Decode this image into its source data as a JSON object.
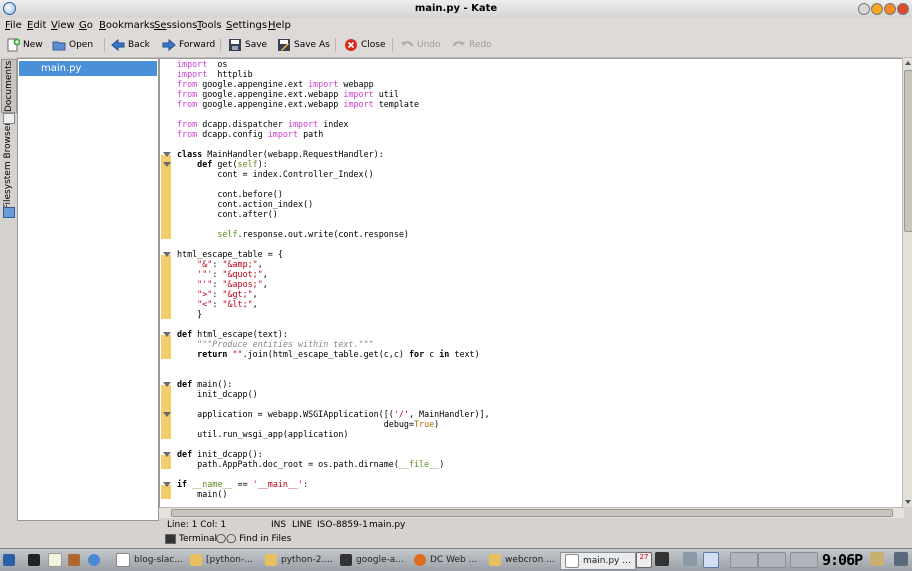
{
  "window": {
    "title": "main.py - Kate"
  },
  "menu": [
    {
      "label": "File",
      "u": "F",
      "rest": "ile"
    },
    {
      "label": "Edit",
      "u": "E",
      "rest": "dit"
    },
    {
      "label": "View",
      "u": "V",
      "rest": "iew"
    },
    {
      "label": "Go",
      "u": "G",
      "rest": "o"
    },
    {
      "label": "Bookmarks",
      "u": "B",
      "rest": "ookmarks"
    },
    {
      "label": "Sessions",
      "u": "Se",
      "rest": "ssions"
    },
    {
      "label": "Tools",
      "u": "T",
      "rest": "ools"
    },
    {
      "label": "Settings",
      "u": "S",
      "rest": "ettings"
    },
    {
      "label": "Help",
      "u": "H",
      "rest": "elp"
    }
  ],
  "toolbar": {
    "new": "New",
    "open": "Open",
    "back": "Back",
    "forward": "Forward",
    "save": "Save",
    "save_as": "Save As",
    "close": "Close",
    "undo": "Undo",
    "redo": "Redo"
  },
  "sidetabs": {
    "documents": "Documents",
    "filesystem": "Filesystem Browser"
  },
  "documents": [
    "main.py"
  ],
  "code_lines": [
    [
      [
        "imp",
        "import"
      ],
      [
        "",
        "  os"
      ]
    ],
    [
      [
        "imp",
        "import"
      ],
      [
        "",
        "  httplib"
      ]
    ],
    [
      [
        "imp",
        "from"
      ],
      [
        "",
        " google.appengine.ext "
      ],
      [
        "imp",
        "import"
      ],
      [
        "",
        " webapp"
      ]
    ],
    [
      [
        "imp",
        "from"
      ],
      [
        "",
        " google.appengine.ext.webapp "
      ],
      [
        "imp",
        "import"
      ],
      [
        "",
        " util"
      ]
    ],
    [
      [
        "imp",
        "from"
      ],
      [
        "",
        " google.appengine.ext.webapp "
      ],
      [
        "imp",
        "import"
      ],
      [
        "",
        " template"
      ]
    ],
    [],
    [
      [
        "imp",
        "from"
      ],
      [
        "",
        " dcapp.dispatcher "
      ],
      [
        "imp",
        "import"
      ],
      [
        "",
        " index"
      ]
    ],
    [
      [
        "imp",
        "from"
      ],
      [
        "",
        " dcapp.config "
      ],
      [
        "imp",
        "import"
      ],
      [
        "",
        " path"
      ]
    ],
    [],
    [
      [
        "kw",
        "class"
      ],
      [
        "",
        " MainHandler(webapp.RequestHandler):"
      ]
    ],
    [
      [
        "",
        "    "
      ],
      [
        "kw",
        "def"
      ],
      [
        "",
        " get("
      ],
      [
        "slf",
        "self"
      ],
      [
        "",
        "):"
      ]
    ],
    [
      [
        "",
        "        cont = index.Controller_Index()"
      ]
    ],
    [],
    [
      [
        "",
        "        cont.before()"
      ]
    ],
    [
      [
        "",
        "        cont.action_index()"
      ]
    ],
    [
      [
        "",
        "        cont.after()"
      ]
    ],
    [],
    [
      [
        "",
        "        "
      ],
      [
        "slf",
        "self"
      ],
      [
        "",
        ".response.out.write(cont.response)"
      ]
    ],
    [],
    [
      [
        "",
        "html_escape_table = {"
      ]
    ],
    [
      [
        "",
        "    "
      ],
      [
        "str",
        "\"&\""
      ],
      [
        "",
        ": "
      ],
      [
        "str",
        "\"&amp;\""
      ],
      [
        "",
        ","
      ]
    ],
    [
      [
        "",
        "    "
      ],
      [
        "str",
        "'\"'"
      ],
      [
        "",
        ": "
      ],
      [
        "str",
        "\"&quot;\""
      ],
      [
        "",
        ","
      ]
    ],
    [
      [
        "",
        "    "
      ],
      [
        "str",
        "\"'\""
      ],
      [
        "",
        ": "
      ],
      [
        "str",
        "\"&apos;\""
      ],
      [
        "",
        ","
      ]
    ],
    [
      [
        "",
        "    "
      ],
      [
        "str",
        "\">\""
      ],
      [
        "",
        ": "
      ],
      [
        "str",
        "\"&gt;\""
      ],
      [
        "",
        ","
      ]
    ],
    [
      [
        "",
        "    "
      ],
      [
        "str",
        "\"<\""
      ],
      [
        "",
        ": "
      ],
      [
        "str",
        "\"&lt;\""
      ],
      [
        "",
        ","
      ]
    ],
    [
      [
        "",
        "    }"
      ]
    ],
    [],
    [
      [
        "kw",
        "def"
      ],
      [
        "",
        " html_escape(text):"
      ]
    ],
    [
      [
        "",
        "    "
      ],
      [
        "doc",
        "\"\"\"Produce entities within text.\"\"\""
      ]
    ],
    [
      [
        "",
        "    "
      ],
      [
        "kw",
        "return"
      ],
      [
        "",
        " "
      ],
      [
        "str",
        "\"\""
      ],
      [
        "",
        ".join(html_escape_table.get(c,c) "
      ],
      [
        "kw",
        "for"
      ],
      [
        "",
        " c "
      ],
      [
        "kw",
        "in"
      ],
      [
        "",
        " text)"
      ]
    ],
    [],
    [],
    [
      [
        "kw",
        "def"
      ],
      [
        "",
        " main():"
      ]
    ],
    [
      [
        "",
        "    init_dcapp()"
      ]
    ],
    [],
    [
      [
        "",
        "    application = webapp.WSGIApplication([("
      ],
      [
        "str",
        "'/'"
      ],
      [
        "",
        ", MainHandler)],"
      ]
    ],
    [
      [
        "",
        "                                         debug="
      ],
      [
        "bool",
        "True"
      ],
      [
        "",
        ")"
      ]
    ],
    [
      [
        "",
        "    util.run_wsgi_app(application)"
      ]
    ],
    [],
    [
      [
        "kw",
        "def"
      ],
      [
        "",
        " init_dcapp():"
      ]
    ],
    [
      [
        "",
        "    path.AppPath.doc_root = os.path.dirname("
      ],
      [
        "slf",
        "__file__"
      ],
      [
        "",
        ")"
      ]
    ],
    [],
    [
      [
        "kw",
        "if"
      ],
      [
        "",
        " "
      ],
      [
        "slf",
        "__name__"
      ],
      [
        "",
        " == "
      ],
      [
        "str",
        "'__main__'"
      ],
      [
        "",
        ":"
      ]
    ],
    [
      [
        "",
        "    main()"
      ]
    ]
  ],
  "status": {
    "position": "Line: 1 Col: 1",
    "mode": "INS",
    "selection": "LINE",
    "encoding": "ISO-8859-1",
    "filename": "main.py"
  },
  "bottom_tabs": {
    "terminal": "Terminal",
    "find": "Find in Files"
  },
  "taskbar": {
    "tasks": [
      "blog-slac...",
      "[python-...",
      "python-2....",
      "google-a...",
      "DC Web ...",
      "webcron ...",
      "main.py ..."
    ],
    "clock": "9:06P",
    "calendar_day": "27"
  },
  "colors": {
    "selection": "#4a90d9",
    "fold_bar": "#f2cf6c",
    "keyword_import": "#d43ad4",
    "string": "#c0001a"
  }
}
